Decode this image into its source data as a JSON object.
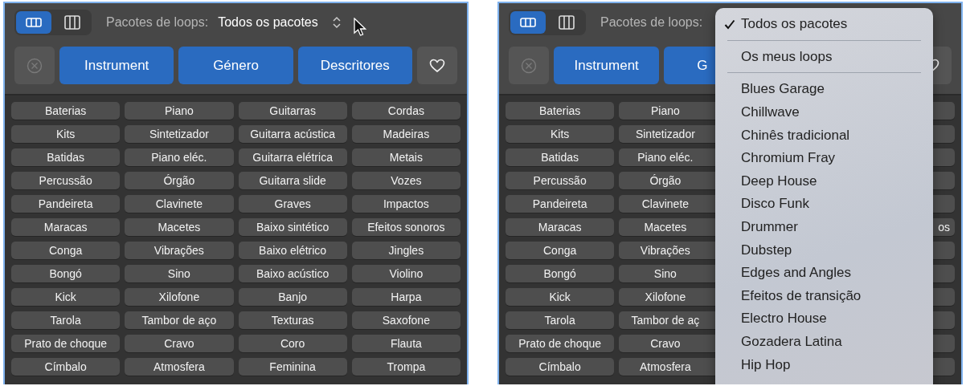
{
  "panels": [
    {
      "view_modes": [
        {
          "kind": "rows",
          "selected": true
        },
        {
          "kind": "columns",
          "selected": false
        }
      ],
      "loop_packs": {
        "label": "Pacotes de loops:",
        "value": "Todos os pacotes"
      },
      "clear_button": {
        "disabled": true
      },
      "category_buttons": [
        {
          "label": "Instrument"
        },
        {
          "label": "Género"
        },
        {
          "label": "Descritores"
        }
      ],
      "keywords": [
        {
          "column_1": "Baterias",
          "column_2": "Piano",
          "column_3": "Guitarras",
          "column_4": "Cordas"
        },
        {
          "column_1": "Kits",
          "column_2": "Sintetizador",
          "column_3": "Guitarra acústica",
          "column_4": "Madeiras"
        },
        {
          "column_1": "Batidas",
          "column_2": "Piano eléc.",
          "column_3": "Guitarra elétrica",
          "column_4": "Metais"
        },
        {
          "column_1": "Percussão",
          "column_2": "Órgão",
          "column_3": "Guitarra slide",
          "column_4": "Vozes"
        },
        {
          "column_1": "Pandeireta",
          "column_2": "Clavinete",
          "column_3": "Graves",
          "column_4": "Impactos"
        },
        {
          "column_1": "Maracas",
          "column_2": "Macetes",
          "column_3": "Baixo sintético",
          "column_4": "Efeitos sonoros"
        },
        {
          "column_1": "Conga",
          "column_2": "Vibrações",
          "column_3": "Baixo elétrico",
          "column_4": "Jingles"
        },
        {
          "column_1": "Bongó",
          "column_2": "Sino",
          "column_3": "Baixo acústico",
          "column_4": "Violino"
        },
        {
          "column_1": "Kick",
          "column_2": "Xilofone",
          "column_3": "Banjo",
          "column_4": "Harpa"
        },
        {
          "column_1": "Tarola",
          "column_2": "Tambor de aço",
          "column_3": "Texturas",
          "column_4": "Saxofone"
        },
        {
          "column_1": "Prato de choque",
          "column_2": "Cravo",
          "column_3": "Coro",
          "column_4": "Flauta"
        },
        {
          "column_1": "Címbalo",
          "column_2": "Atmosfera",
          "column_3": "Feminina",
          "column_4": "Trompa"
        }
      ]
    },
    {
      "view_modes": [
        {
          "kind": "rows",
          "selected": true
        },
        {
          "kind": "columns",
          "selected": false
        }
      ],
      "loop_packs": {
        "label": "Pacotes de loops:"
      },
      "clear_button": {
        "disabled": true
      },
      "category_buttons": [
        {
          "label": "Instrument"
        },
        {
          "label": "G"
        }
      ],
      "keywords": [
        {
          "column_1": "Baterias",
          "column_2": "Piano"
        },
        {
          "column_1": "Kits",
          "column_2": "Sintetizador"
        },
        {
          "column_1": "Batidas",
          "column_2": "Piano eléc."
        },
        {
          "column_1": "Percussão",
          "column_2": "Órgão"
        },
        {
          "column_1": "Pandeireta",
          "column_2": "Clavinete"
        },
        {
          "column_1": "Maracas",
          "column_2": "Macetes",
          "column_4": "os"
        },
        {
          "column_1": "Conga",
          "column_2": "Vibrações"
        },
        {
          "column_1": "Bongó",
          "column_2": "Sino"
        },
        {
          "column_1": "Kick",
          "column_2": "Xilofone"
        },
        {
          "column_1": "Tarola",
          "column_2": "Tambor de aç"
        },
        {
          "column_1": "Prato de choque",
          "column_2": "Cravo"
        },
        {
          "column_1": "Címbalo",
          "column_2": "Atmosfera"
        }
      ],
      "menu": {
        "sections": [
          [
            {
              "label": "Todos os pacotes",
              "selected": true
            }
          ],
          [
            {
              "label": "Os meus loops",
              "selected": false
            }
          ],
          [
            {
              "label": "Blues Garage",
              "selected": false
            },
            {
              "label": "Chillwave",
              "selected": false
            },
            {
              "label": "Chinês tradicional",
              "selected": false
            },
            {
              "label": "Chromium Fray",
              "selected": false
            },
            {
              "label": "Deep House",
              "selected": false
            },
            {
              "label": "Disco Funk",
              "selected": false
            },
            {
              "label": "Drummer",
              "selected": false
            },
            {
              "label": "Dubstep",
              "selected": false
            },
            {
              "label": "Edges and Angles",
              "selected": false
            },
            {
              "label": "Efeitos de transição",
              "selected": false
            },
            {
              "label": "Electro House",
              "selected": false
            },
            {
              "label": "Gozadera Latina",
              "selected": false
            },
            {
              "label": "Hip Hop",
              "selected": false
            }
          ]
        ]
      }
    }
  ]
}
